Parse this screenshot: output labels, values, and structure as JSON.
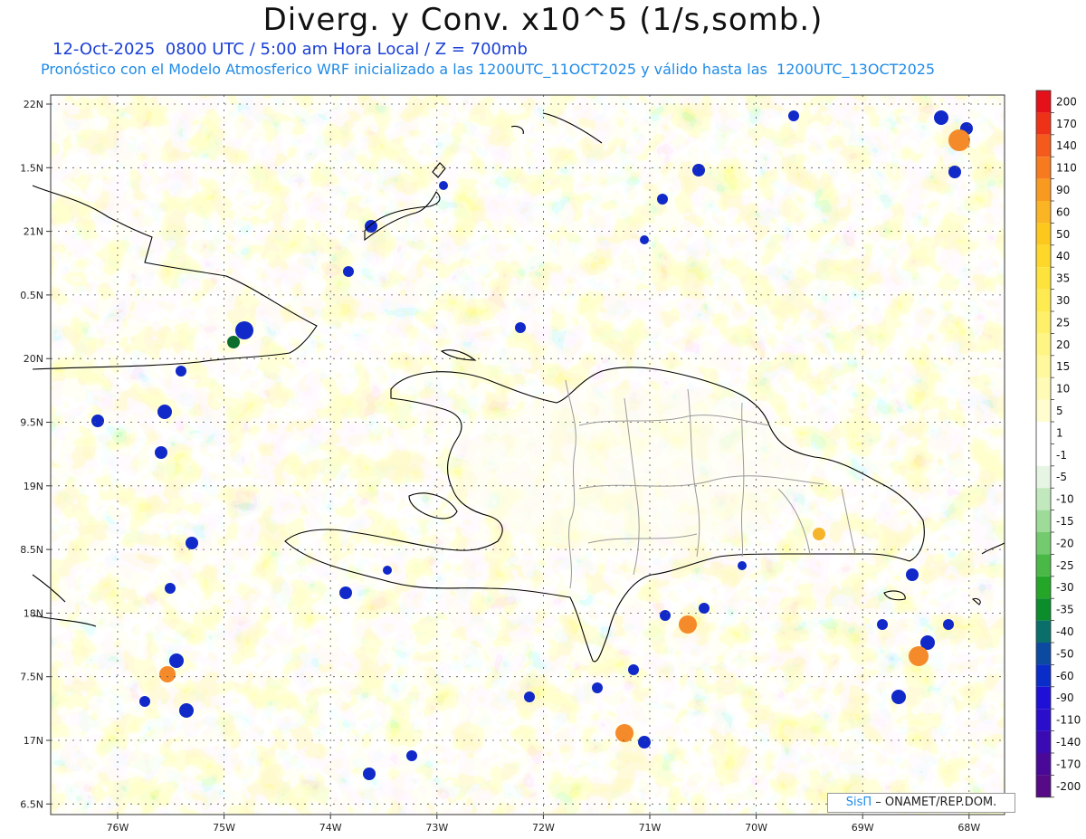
{
  "header": {
    "title": "Diverg. y Conv. x10^5 (1/s,somb.)",
    "subtitle_1": "12-Oct-2025  0800 UTC / 5:00 am Hora Local / Z = 700mb",
    "subtitle_2": "Pronóstico con el Modelo Atmosferico WRF inicializado a las 1200UTC_11OCT2025 y válido hasta las  1200UTC_13OCT2025"
  },
  "axes": {
    "lat_labels": [
      "22N",
      "1.5N",
      "21N",
      "0.5N",
      "20N",
      "9.5N",
      "19N",
      "8.5N",
      "18N",
      "7.5N",
      "17N",
      "6.5N"
    ],
    "lon_labels": [
      "76W",
      "75W",
      "74W",
      "73W",
      "72W",
      "71W",
      "70W",
      "69W",
      "68W"
    ]
  },
  "colorbar": {
    "labels": [
      "200",
      "170",
      "140",
      "110",
      "90",
      "60",
      "50",
      "40",
      "35",
      "30",
      "25",
      "20",
      "15",
      "10",
      "5",
      "1",
      "-1",
      "-5",
      "-10",
      "-15",
      "-20",
      "-25",
      "-30",
      "-35",
      "-40",
      "-50",
      "-60",
      "-90",
      "-110",
      "-140",
      "-170",
      "-200"
    ],
    "colors": [
      "#e4101a",
      "#ee3218",
      "#f45a1c",
      "#f77a1e",
      "#f99a20",
      "#fbb424",
      "#fcc81e",
      "#fdd82a",
      "#fde33c",
      "#feeb52",
      "#fff06a",
      "#fff584",
      "#fff89c",
      "#fffab6",
      "#fffcd0",
      "#ffffff",
      "#ffffff",
      "#e6f5e4",
      "#c2e8bd",
      "#9edb98",
      "#74cb6f",
      "#4ab847",
      "#24a628",
      "#0b8d2c",
      "#0a6e6a",
      "#0b4aa0",
      "#0a2cc8",
      "#1e10d6",
      "#2a0ecc",
      "#3a0ab2",
      "#4a0898",
      "#560a86"
    ]
  },
  "credit": {
    "brand": "SisΠ",
    "text": "– ONAMET/REP.DOM."
  },
  "colors": {
    "land_outline": "#000000",
    "province_lines": "#999999",
    "grid": "#555555",
    "title_blue": "#1a3fd6",
    "subtitle_blue": "#1f8be8"
  }
}
